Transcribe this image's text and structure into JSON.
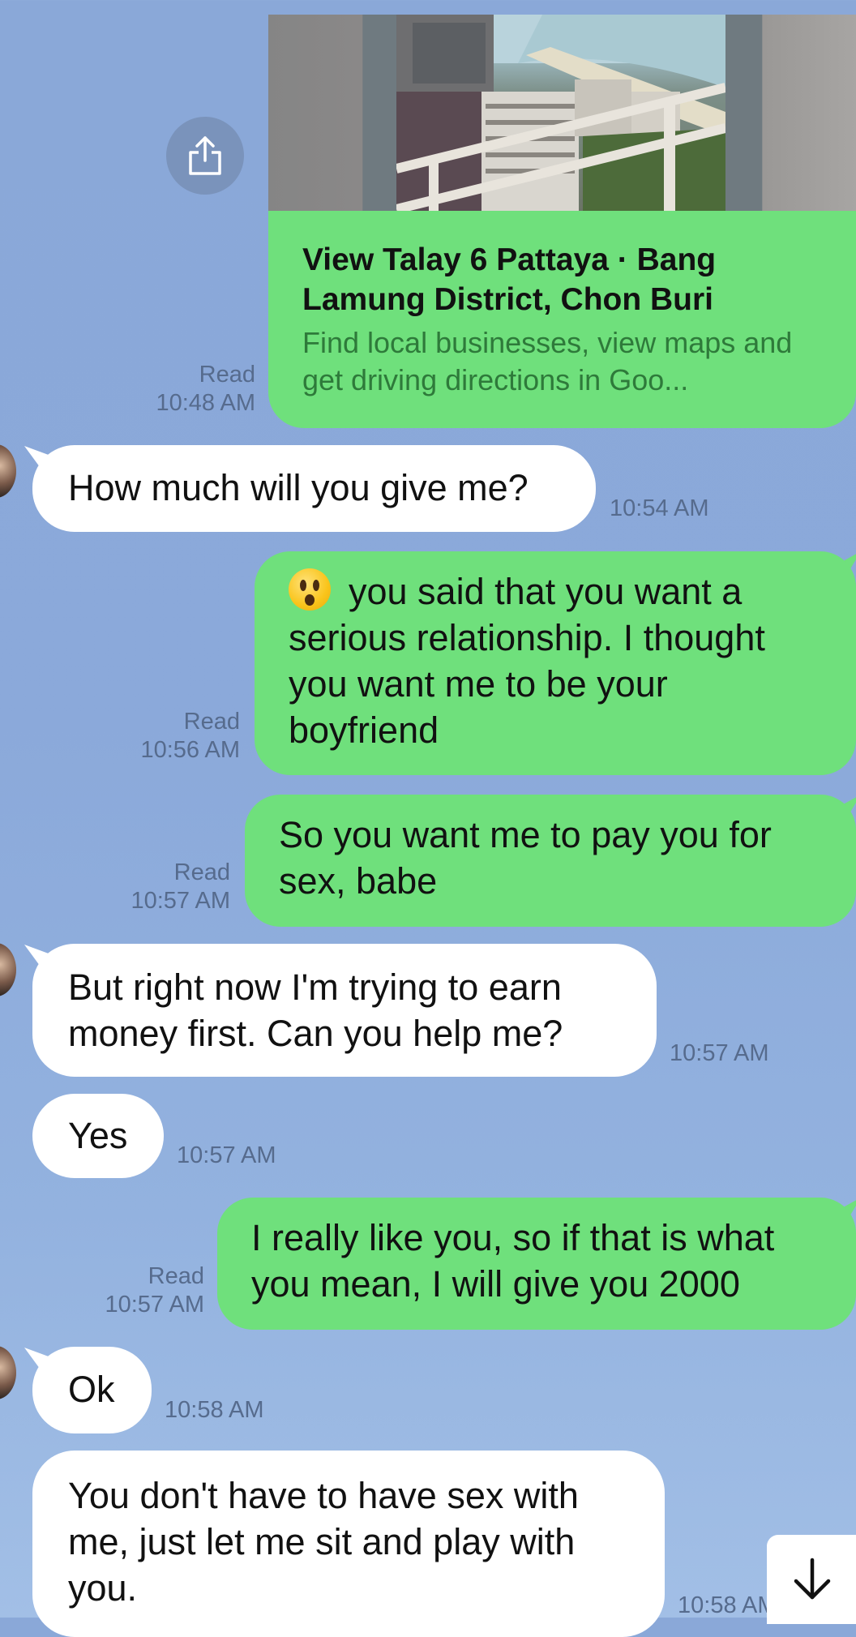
{
  "colors": {
    "background": "#8ba9da",
    "incoming_bubble": "#ffffff",
    "outgoing_bubble": "#6fe07c",
    "meta_text": "#566b8d",
    "link_desc": "#2e7a3a"
  },
  "link_card": {
    "title": "View Talay 6 Pattaya · Bang Lamung District, Chon Buri",
    "description": "Find local businesses, view maps and get driving directions in Goo...",
    "read_label": "Read",
    "time": "10:48 AM",
    "share_icon": "share-icon"
  },
  "messages": [
    {
      "direction": "in",
      "text": "How much will you give me?",
      "time": "10:54 AM"
    },
    {
      "direction": "out",
      "emoji": "hushed-face",
      "text": "you said that you want a serious relationship. I thought you want me to be your boyfriend",
      "read_label": "Read",
      "time": "10:56 AM"
    },
    {
      "direction": "out",
      "text": "So you want me to pay you for sex, babe",
      "read_label": "Read",
      "time": "10:57 AM"
    },
    {
      "direction": "in",
      "text": "But right now I'm trying to earn money first. Can you help me?",
      "time": "10:57 AM"
    },
    {
      "direction": "in",
      "text": "Yes",
      "time": "10:57 AM"
    },
    {
      "direction": "out",
      "text": "I really like you, so if that is what you mean, I will give you 2000",
      "read_label": "Read",
      "time": "10:57 AM"
    },
    {
      "direction": "in",
      "text": "Ok",
      "time": "10:58 AM"
    },
    {
      "direction": "in",
      "text": "You don't have to have sex with me, just let me sit and play with you.",
      "time": "10:58 AM"
    }
  ],
  "scroll_down_icon": "arrow-down-icon"
}
